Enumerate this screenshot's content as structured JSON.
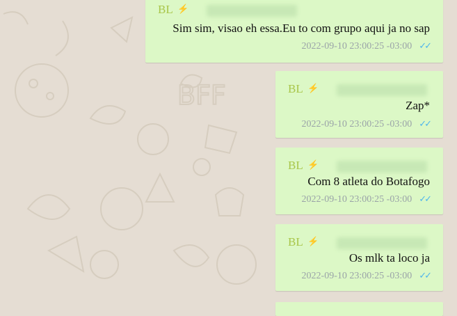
{
  "messages": [
    {
      "sender": "BL",
      "text": "Sim sim, visao eh essa.Eu to com grupo aqui ja no sap",
      "timestamp": "2022-09-10 23:00:25 -03:00",
      "status_icon": "double-check-icon"
    },
    {
      "sender": "BL",
      "text": "Zap*",
      "timestamp": "2022-09-10 23:00:25 -03:00",
      "status_icon": "double-check-icon"
    },
    {
      "sender": "BL",
      "text": "Com 8 atleta do Botafogo",
      "timestamp": "2022-09-10 23:00:25 -03:00",
      "status_icon": "double-check-icon"
    },
    {
      "sender": "BL",
      "text": "Os mlk ta loco ja",
      "timestamp": "2022-09-10 23:00:25 -03:00",
      "status_icon": "double-check-icon"
    }
  ],
  "colors": {
    "bubble": "#dcf8c6",
    "background": "#e5ddd3",
    "sender": "#a9c64a",
    "ticks": "#4fb6ec"
  }
}
